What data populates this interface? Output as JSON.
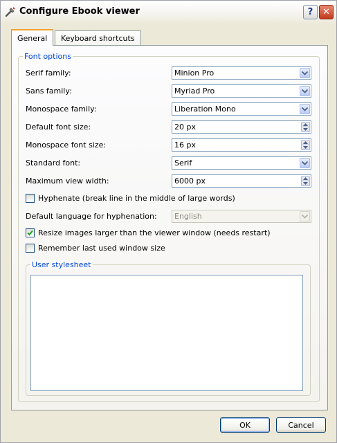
{
  "window": {
    "title": "Configure Ebook viewer",
    "help_glyph": "?",
    "close_glyph": "✕"
  },
  "tabs": [
    {
      "label": "General",
      "active": true
    },
    {
      "label": "Keyboard shortcuts",
      "active": false
    }
  ],
  "font_options": {
    "group_title": "Font options",
    "serif_family": {
      "label": "Serif family:",
      "value": "Minion Pro"
    },
    "sans_family": {
      "label": "Sans family:",
      "value": "Myriad Pro"
    },
    "monospace_family": {
      "label": "Monospace family:",
      "value": "Liberation Mono"
    },
    "default_font_size": {
      "label": "Default font size:",
      "value": "20 px"
    },
    "monospace_font_size": {
      "label": "Monospace font size:",
      "value": "16 px"
    },
    "standard_font": {
      "label": "Standard font:",
      "value": "Serif"
    },
    "max_view_width": {
      "label": "Maximum view width:",
      "value": "6000 px"
    },
    "hyphenate": {
      "label": "Hyphenate (break line in the middle of large words)",
      "checked": false
    },
    "hyphenation_language": {
      "label": "Default language for hyphenation:",
      "value": "English",
      "enabled": false
    },
    "resize_images": {
      "label": "Resize images larger than the viewer window (needs restart)",
      "checked": true
    },
    "remember_window_size": {
      "label": "Remember last used window size",
      "checked": false
    },
    "user_stylesheet": {
      "group_title": "User stylesheet",
      "value": ""
    }
  },
  "buttons": {
    "ok": "OK",
    "cancel": "Cancel"
  },
  "colors": {
    "accent_title": "#0046d5",
    "active_tab_highlight": "#f4a32a",
    "close_button": "#c23a1c"
  }
}
